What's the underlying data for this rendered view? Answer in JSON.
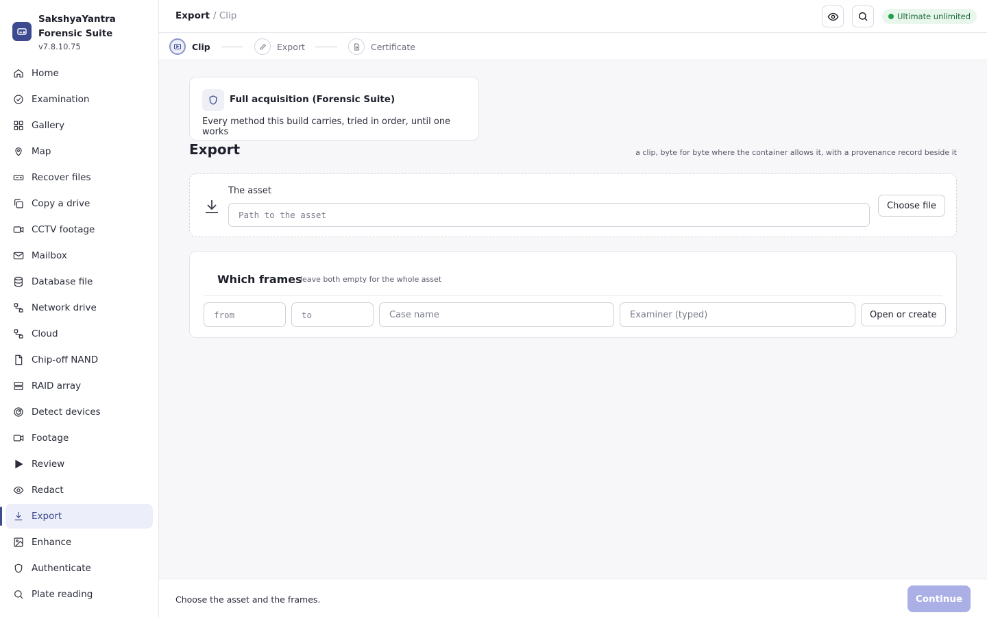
{
  "app": {
    "name": "SakshyaYantra Forensic Suite",
    "version": "v7.8.10.75"
  },
  "sidebar": {
    "items": [
      {
        "label": "Home",
        "icon": "home-icon"
      },
      {
        "label": "Examination",
        "icon": "check-circle-icon"
      },
      {
        "label": "Gallery",
        "icon": "grid-icon"
      },
      {
        "label": "Map",
        "icon": "map-pin-icon"
      },
      {
        "label": "Recover files",
        "icon": "hard-drive-icon"
      },
      {
        "label": "Copy a drive",
        "icon": "copy-icon"
      },
      {
        "label": "CCTV footage",
        "icon": "video-icon"
      },
      {
        "label": "Mailbox",
        "icon": "mail-icon"
      },
      {
        "label": "Database file",
        "icon": "database-icon"
      },
      {
        "label": "Network drive",
        "icon": "network-icon"
      },
      {
        "label": "Cloud",
        "icon": "cloud-network-icon"
      },
      {
        "label": "Chip-off NAND",
        "icon": "file-icon"
      },
      {
        "label": "RAID array",
        "icon": "server-icon"
      },
      {
        "label": "Detect devices",
        "icon": "radar-icon"
      },
      {
        "label": "Footage",
        "icon": "video-icon"
      },
      {
        "label": "Review",
        "icon": "play-icon"
      },
      {
        "label": "Redact",
        "icon": "eye-icon"
      },
      {
        "label": "Export",
        "icon": "download-icon",
        "active": true
      },
      {
        "label": "Enhance",
        "icon": "image-icon"
      },
      {
        "label": "Authenticate",
        "icon": "shield-icon"
      },
      {
        "label": "Plate reading",
        "icon": "search-icon"
      }
    ]
  },
  "header": {
    "breadcrumb_main": "Export",
    "breadcrumb_current": "/ Clip",
    "badge": "Ultimate  unlimited",
    "badge_color": "#22a04a"
  },
  "stepper": {
    "steps": [
      {
        "label": "Clip",
        "active": true
      },
      {
        "label": "Export",
        "active": false
      },
      {
        "label": "Certificate",
        "active": false
      }
    ]
  },
  "method_card": {
    "title": "Full acquisition (Forensic Suite)",
    "description": "Every method this build carries, tried in order, until one works"
  },
  "page": {
    "title": "Export",
    "subtitle": "a clip, byte for byte where the container allows it, with a provenance record beside it"
  },
  "asset": {
    "label": "The asset",
    "placeholder": "Path to the asset",
    "value": "",
    "choose_button": "Choose file"
  },
  "frames": {
    "title": "Which frames",
    "hint": "leave both empty for the whole asset",
    "from_placeholder": "from",
    "to_placeholder": "to",
    "case_placeholder": "Case name",
    "examiner_placeholder": "Examiner (typed)",
    "open_button": "Open or create"
  },
  "footer": {
    "status": "Choose the asset and the frames.",
    "continue_label": "Continue",
    "continue_disabled": true
  },
  "colors": {
    "accent": "#3d4a8f",
    "continue_disabled": "#aab0e6"
  }
}
